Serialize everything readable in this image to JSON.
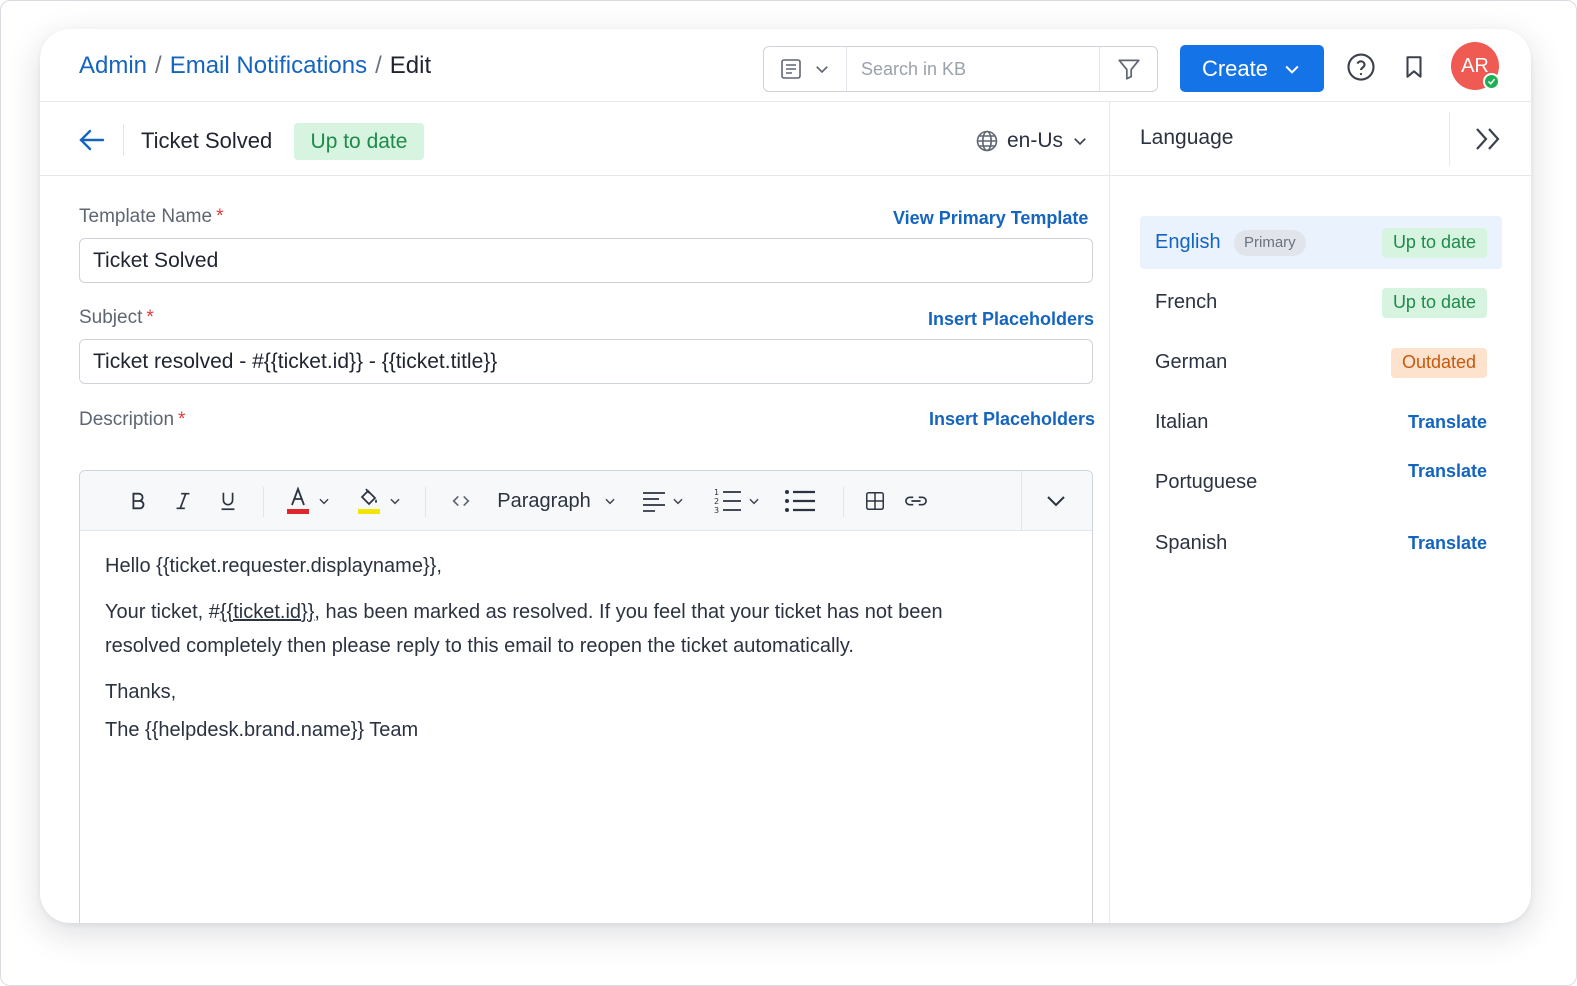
{
  "header": {
    "breadcrumb": [
      "Admin",
      "Email Notifications",
      "Edit"
    ],
    "breadcrumb_separator": "/",
    "search": {
      "placeholder": "Search in KB",
      "type_icon": "article-icon",
      "filter_icon": "filter-icon"
    },
    "create_label": "Create",
    "help_icon": "question-circle-icon",
    "bookmark_icon": "bookmark-icon",
    "avatar_initials": "AR"
  },
  "subheader": {
    "title": "Ticket Solved",
    "status": "Up to date",
    "locale": "en-Us"
  },
  "form": {
    "template_name": {
      "label": "Template Name",
      "required_mark": "*",
      "link": "View Primary Template",
      "value": "Ticket Solved"
    },
    "subject": {
      "label": "Subject",
      "required_mark": "*",
      "link": "Insert Placeholders",
      "value": "Ticket resolved - #{{ticket.id}} - {{ticket.title}}"
    },
    "description": {
      "label": "Description",
      "required_mark": "*",
      "link": "Insert Placeholders"
    }
  },
  "toolbar": {
    "block_format": "Paragraph"
  },
  "editor": {
    "greeting": "Hello {{ticket.requester.displayname}},",
    "body_pre": "Your ticket, #",
    "body_link": "{{ticket.id}}",
    "body_post": ", has been marked as resolved. If you feel that your ticket has not been resolved completely then please reply to this email to reopen the ticket automatically.",
    "closing": "Thanks,",
    "signature": "The {{helpdesk.brand.name}} Team"
  },
  "language_panel": {
    "title": "Language",
    "languages": [
      {
        "name": "English",
        "tag": "Primary",
        "status": "Up to date"
      },
      {
        "name": "French",
        "status": "Up to date"
      },
      {
        "name": "German",
        "status": "Outdated"
      },
      {
        "name": "Italian",
        "action": "Translate"
      },
      {
        "name": "Portuguese",
        "action": "Translate"
      },
      {
        "name": "Spanish",
        "action": "Translate"
      }
    ]
  },
  "colors": {
    "accent": "#1473e6",
    "link": "#1565c0",
    "status_green_bg": "#d7f4e0",
    "status_green_text": "#1f8a4a",
    "status_orange_bg": "#fde3cd",
    "status_orange_text": "#c7580d",
    "avatar": "#ef5a52",
    "text_color_swatch": "#e0262d",
    "highlight_swatch": "#f2e600"
  }
}
